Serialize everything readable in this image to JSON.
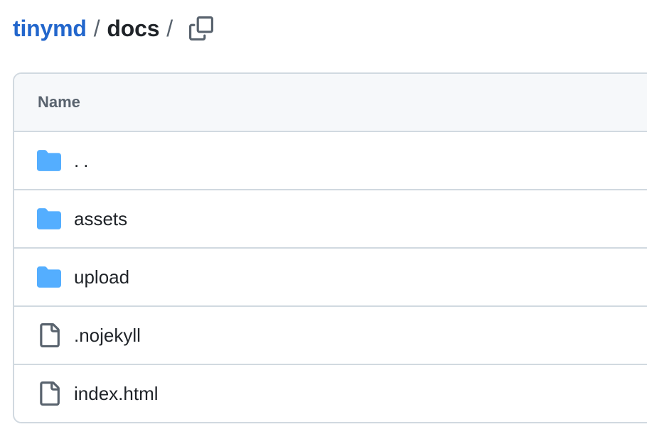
{
  "breadcrumb": {
    "repo": "tinymd",
    "separator": "/",
    "current": "docs",
    "trailing": "/"
  },
  "table": {
    "header": "Name",
    "rows": [
      {
        "label": "..",
        "icon": "folder-icon"
      },
      {
        "label": "assets",
        "icon": "folder-icon"
      },
      {
        "label": "upload",
        "icon": "folder-icon"
      },
      {
        "label": ".nojekyll",
        "icon": "file-icon"
      },
      {
        "label": "index.html",
        "icon": "file-icon"
      }
    ]
  },
  "colors": {
    "link": "#2266cc",
    "folder": "#54aeff",
    "border": "#d1d9e0",
    "header_bg": "#f6f8fa",
    "muted": "#59636e"
  }
}
